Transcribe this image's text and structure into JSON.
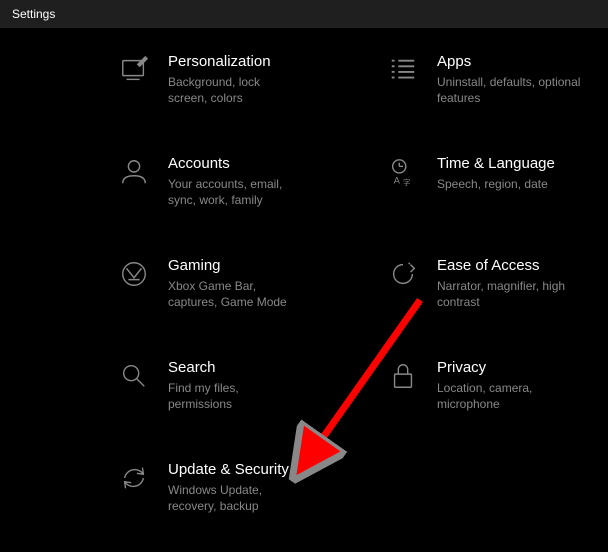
{
  "window": {
    "title": "Settings"
  },
  "tiles": [
    {
      "title": "Personalization",
      "sub": "Background, lock screen, colors"
    },
    {
      "title": "Apps",
      "sub": "Uninstall, defaults, optional features"
    },
    {
      "title": "Accounts",
      "sub": "Your accounts, email, sync, work, family"
    },
    {
      "title": "Time & Language",
      "sub": "Speech, region, date"
    },
    {
      "title": "Gaming",
      "sub": "Xbox Game Bar, captures, Game Mode"
    },
    {
      "title": "Ease of Access",
      "sub": "Narrator, magnifier, high contrast"
    },
    {
      "title": "Search",
      "sub": "Find my files, permissions"
    },
    {
      "title": "Privacy",
      "sub": "Location, camera, microphone"
    },
    {
      "title": "Update & Security",
      "sub": "Windows Update, recovery, backup"
    }
  ]
}
